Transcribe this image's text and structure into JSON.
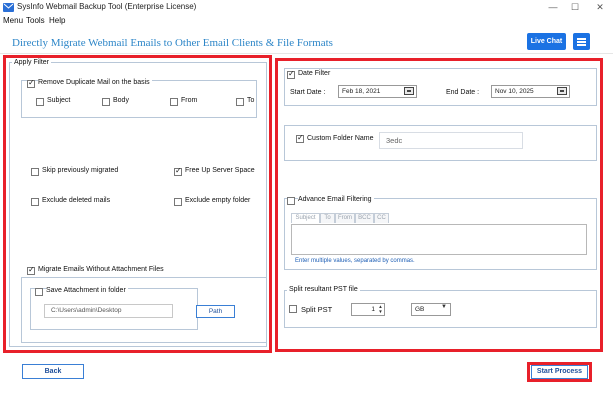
{
  "window": {
    "title": "SysInfo Webmail Backup Tool (Enterprise License)",
    "minimize": "—",
    "maximize": "☐",
    "close": "✕"
  },
  "menu": {
    "items": [
      "Menu",
      "Tools",
      "Help"
    ]
  },
  "header": {
    "title": "Directly Migrate Webmail Emails to Other Email Clients & File Formats",
    "live_chat": "Live Chat"
  },
  "apply_filter": {
    "title": "Apply Filter",
    "remove_duplicate": {
      "label": "Remove Duplicate Mail on the basis",
      "checked": true
    },
    "duplicate_options": [
      {
        "label": "Subject",
        "checked": false
      },
      {
        "label": "Body",
        "checked": false
      },
      {
        "label": "From",
        "checked": false
      },
      {
        "label": "To",
        "checked": false
      }
    ],
    "skip_previously_migrated": {
      "label": "Skip previously migrated",
      "checked": false
    },
    "free_up_server_space": {
      "label": "Free Up Server Space",
      "checked": true
    },
    "exclude_deleted": {
      "label": "Exclude deleted mails",
      "checked": false
    },
    "exclude_empty_folder": {
      "label": "Exclude empty folder",
      "checked": false
    },
    "migrate_without_attachment": {
      "label": "Migrate Emails Without Attachment Files",
      "checked": true
    },
    "save_attachment": {
      "label": "Save Attachment in folder",
      "checked": false
    },
    "attachment_path": "C:\\Users\\admin\\Desktop",
    "path_button": "Path"
  },
  "date_filter": {
    "label": "Date Filter",
    "checked": true,
    "start_label": "Start Date :",
    "start_value": "Feb 18, 2021",
    "end_label": "End Date :",
    "end_value": "Nov 10, 2025"
  },
  "custom_folder": {
    "label": "Custom Folder Name",
    "checked": true,
    "value": "3edc"
  },
  "advance_filter": {
    "label": "Advance Email Filtering",
    "checked": false,
    "tabs": [
      "Subject",
      "To",
      "From",
      "BCC",
      "CC"
    ],
    "hint": "Enter multiple values, separated by commas."
  },
  "split_pst": {
    "title": "Split resultant PST file",
    "label": "Split PST",
    "checked": false,
    "size_value": "1",
    "unit_value": "GB"
  },
  "footer": {
    "back": "Back",
    "start_process": "Start Process"
  },
  "colors": {
    "accent": "#1b72e3",
    "highlight": "#e8202a",
    "title_text": "#2d86c8"
  }
}
